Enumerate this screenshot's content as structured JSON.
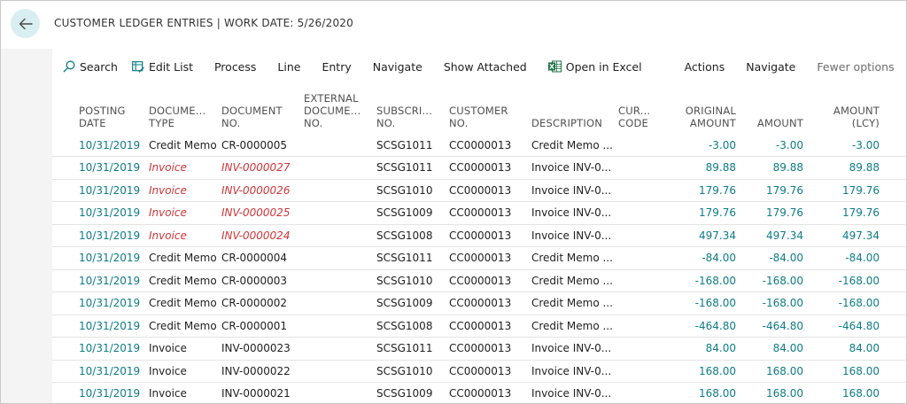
{
  "header": {
    "title": "CUSTOMER LEDGER ENTRIES | WORK DATE: 5/26/2020"
  },
  "toolbar": {
    "search": "Search",
    "edit_list": "Edit List",
    "process": "Process",
    "line": "Line",
    "entry": "Entry",
    "navigate": "Navigate",
    "show_attached": "Show Attached",
    "open_in_excel": "Open in Excel",
    "actions": "Actions",
    "navigate2": "Navigate",
    "fewer_options": "Fewer options"
  },
  "columns": {
    "posting_date": [
      "POSTING",
      "DATE"
    ],
    "doc_type": [
      "DOCUME...",
      "TYPE"
    ],
    "doc_no": [
      "DOCUMENT",
      "NO."
    ],
    "ext_doc": [
      "EXTERNAL",
      "DOCUME...",
      "NO."
    ],
    "subscr": [
      "SUBSCRI...",
      "NO."
    ],
    "customer": [
      "CUSTOMER",
      "NO."
    ],
    "description": [
      "DESCRIPTION"
    ],
    "currency": [
      "CUR...",
      "CODE"
    ],
    "orig_amount": [
      "ORIGINAL",
      "AMOUNT"
    ],
    "amount": [
      "AMOUNT"
    ],
    "amount_lcy": [
      "AMOUNT",
      "(LCY)"
    ]
  },
  "rows": [
    {
      "date": "10/31/2019",
      "type": "Credit Memo",
      "doc": "CR-0000005",
      "ext": "",
      "sub": "SCSG1011",
      "cust": "CC0000013",
      "desc": "Credit Memo ...",
      "cur": "",
      "orig": "-3.00",
      "amt": "-3.00",
      "lcy": "-3.00",
      "red": false
    },
    {
      "date": "10/31/2019",
      "type": "Invoice",
      "doc": "INV-0000027",
      "ext": "",
      "sub": "SCSG1011",
      "cust": "CC0000013",
      "desc": "Invoice INV-0...",
      "cur": "",
      "orig": "89.88",
      "amt": "89.88",
      "lcy": "89.88",
      "red": true
    },
    {
      "date": "10/31/2019",
      "type": "Invoice",
      "doc": "INV-0000026",
      "ext": "",
      "sub": "SCSG1010",
      "cust": "CC0000013",
      "desc": "Invoice INV-0...",
      "cur": "",
      "orig": "179.76",
      "amt": "179.76",
      "lcy": "179.76",
      "red": true
    },
    {
      "date": "10/31/2019",
      "type": "Invoice",
      "doc": "INV-0000025",
      "ext": "",
      "sub": "SCSG1009",
      "cust": "CC0000013",
      "desc": "Invoice INV-0...",
      "cur": "",
      "orig": "179.76",
      "amt": "179.76",
      "lcy": "179.76",
      "red": true
    },
    {
      "date": "10/31/2019",
      "type": "Invoice",
      "doc": "INV-0000024",
      "ext": "",
      "sub": "SCSG1008",
      "cust": "CC0000013",
      "desc": "Invoice INV-0...",
      "cur": "",
      "orig": "497.34",
      "amt": "497.34",
      "lcy": "497.34",
      "red": true
    },
    {
      "date": "10/31/2019",
      "type": "Credit Memo",
      "doc": "CR-0000004",
      "ext": "",
      "sub": "SCSG1011",
      "cust": "CC0000013",
      "desc": "Credit Memo ...",
      "cur": "",
      "orig": "-84.00",
      "amt": "-84.00",
      "lcy": "-84.00",
      "red": false
    },
    {
      "date": "10/31/2019",
      "type": "Credit Memo",
      "doc": "CR-0000003",
      "ext": "",
      "sub": "SCSG1010",
      "cust": "CC0000013",
      "desc": "Credit Memo ...",
      "cur": "",
      "orig": "-168.00",
      "amt": "-168.00",
      "lcy": "-168.00",
      "red": false
    },
    {
      "date": "10/31/2019",
      "type": "Credit Memo",
      "doc": "CR-0000002",
      "ext": "",
      "sub": "SCSG1009",
      "cust": "CC0000013",
      "desc": "Credit Memo ...",
      "cur": "",
      "orig": "-168.00",
      "amt": "-168.00",
      "lcy": "-168.00",
      "red": false
    },
    {
      "date": "10/31/2019",
      "type": "Credit Memo",
      "doc": "CR-0000001",
      "ext": "",
      "sub": "SCSG1008",
      "cust": "CC0000013",
      "desc": "Credit Memo ...",
      "cur": "",
      "orig": "-464.80",
      "amt": "-464.80",
      "lcy": "-464.80",
      "red": false
    },
    {
      "date": "10/31/2019",
      "type": "Invoice",
      "doc": "INV-0000023",
      "ext": "",
      "sub": "SCSG1011",
      "cust": "CC0000013",
      "desc": "Invoice INV-0...",
      "cur": "",
      "orig": "84.00",
      "amt": "84.00",
      "lcy": "84.00",
      "red": false
    },
    {
      "date": "10/31/2019",
      "type": "Invoice",
      "doc": "INV-0000022",
      "ext": "",
      "sub": "SCSG1010",
      "cust": "CC0000013",
      "desc": "Invoice INV-0...",
      "cur": "",
      "orig": "168.00",
      "amt": "168.00",
      "lcy": "168.00",
      "red": false
    },
    {
      "date": "10/31/2019",
      "type": "Invoice",
      "doc": "INV-0000021",
      "ext": "",
      "sub": "SCSG1009",
      "cust": "CC0000013",
      "desc": "Invoice INV-0...",
      "cur": "",
      "orig": "168.00",
      "amt": "168.00",
      "lcy": "168.00",
      "red": false
    }
  ],
  "icons": {
    "back": "arrow-left-icon",
    "search": "search-icon",
    "edit_list": "edit-list-icon",
    "excel": "excel-icon",
    "filter": "filter-icon",
    "list_view": "list-view-icon"
  },
  "colors": {
    "accent": "#0e7c86",
    "invoice_red": "#d13438",
    "back_circle": "#d9eef0",
    "excel_green": "#1d7044"
  }
}
